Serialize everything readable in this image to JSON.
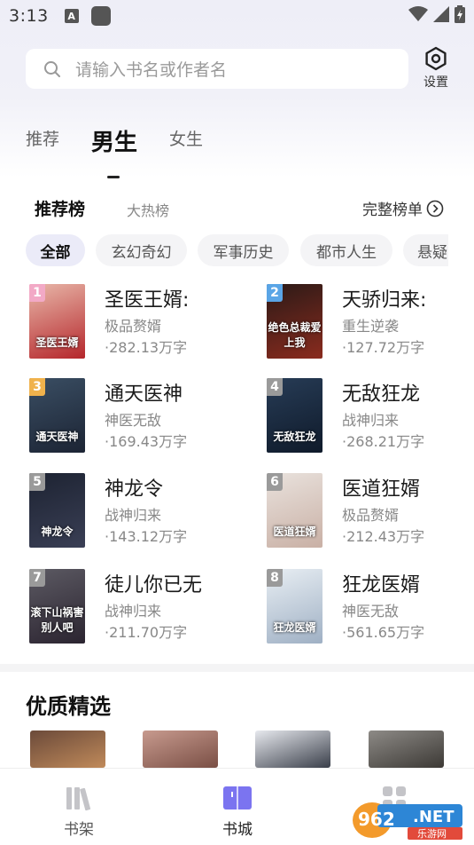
{
  "status_bar": {
    "time": "3:13",
    "icons": [
      "notification-a-icon",
      "app-square-icon",
      "wifi-icon",
      "signal-icon",
      "battery-icon"
    ]
  },
  "search": {
    "placeholder": "请输入书名或作者名",
    "icon": "search-icon"
  },
  "settings": {
    "label": "设置",
    "icon": "gear-icon"
  },
  "gender_tabs": [
    {
      "label": "推荐",
      "active": false
    },
    {
      "label": "男生",
      "active": true
    },
    {
      "label": "女生",
      "active": false
    }
  ],
  "rank_tabs": [
    {
      "label": "推荐榜",
      "active": true
    },
    {
      "label": "大热榜",
      "active": false
    }
  ],
  "full_rank": {
    "label": "完整榜单",
    "icon": "chevron-right-circle-icon"
  },
  "categories": [
    {
      "label": "全部",
      "active": true
    },
    {
      "label": "玄幻奇幻",
      "active": false
    },
    {
      "label": "军事历史",
      "active": false
    },
    {
      "label": "都市人生",
      "active": false
    },
    {
      "label": "悬疑",
      "active": false
    }
  ],
  "books": [
    {
      "rank": "1",
      "title": "圣医王婿:",
      "genre": "极品赘婿",
      "words": "·282.13万字",
      "cover_text": "圣医王婿",
      "badge_color": "#f2a9c6",
      "cover_colors": [
        "#e8b7a9",
        "#b5262b"
      ]
    },
    {
      "rank": "2",
      "title": "天骄归来:",
      "genre": "重生逆袭",
      "words": "·127.72万字",
      "cover_text": "绝色总裁爱上我",
      "badge_color": "#5aa5e6",
      "cover_colors": [
        "#2b1a17",
        "#8a2b1e"
      ]
    },
    {
      "rank": "3",
      "title": "通天医神",
      "genre": "神医无敌",
      "words": "·169.43万字",
      "cover_text": "通天医神",
      "badge_color": "#f0b24c",
      "cover_colors": [
        "#3a4e63",
        "#1c2434"
      ]
    },
    {
      "rank": "4",
      "title": "无敌狂龙",
      "genre": "战神归来",
      "words": "·268.21万字",
      "cover_text": "无敌狂龙",
      "badge_color": "#9a9a9a",
      "cover_colors": [
        "#273c56",
        "#0f1a2a"
      ]
    },
    {
      "rank": "5",
      "title": "神龙令",
      "genre": "战神归来",
      "words": "·143.12万字",
      "cover_text": "神龙令",
      "badge_color": "#9a9a9a",
      "cover_colors": [
        "#1d2332",
        "#3a3f55"
      ]
    },
    {
      "rank": "6",
      "title": "医道狂婿",
      "genre": "极品赘婿",
      "words": "·212.43万字",
      "cover_text": "医道狂婿",
      "badge_color": "#9a9a9a",
      "cover_colors": [
        "#e9e2dd",
        "#c9b0a5"
      ]
    },
    {
      "rank": "7",
      "title": "徒儿你已无",
      "genre": "战神归来",
      "words": "·211.70万字",
      "cover_text": "滚下山祸害别人吧",
      "badge_color": "#9a9a9a",
      "cover_colors": [
        "#5c5a63",
        "#2b2430"
      ]
    },
    {
      "rank": "8",
      "title": "狂龙医婿",
      "genre": "神医无敌",
      "words": "·561.65万字",
      "cover_text": "狂龙医婿",
      "badge_color": "#9a9a9a",
      "cover_colors": [
        "#e8eef3",
        "#9fb0c4"
      ]
    }
  ],
  "quality_section": {
    "title": "优质精选",
    "covers": [
      {
        "colors": [
          "#6b4a3a",
          "#c08a5a"
        ]
      },
      {
        "colors": [
          "#c79a8e",
          "#7a4f45"
        ]
      },
      {
        "colors": [
          "#e7e9ee",
          "#3a3f4a"
        ]
      },
      {
        "colors": [
          "#8d8a86",
          "#3c3935"
        ]
      }
    ]
  },
  "bottom_nav": [
    {
      "label": "书架",
      "icon": "bookshelf-icon",
      "active": false
    },
    {
      "label": "书城",
      "icon": "book-store-icon",
      "active": true
    },
    {
      "label": "",
      "icon": "grid-apps-icon",
      "active": false
    }
  ],
  "watermark": {
    "text": "962.NET",
    "subtext": "乐游网"
  },
  "colors": {
    "accent": "#7b74f0",
    "text_primary": "#111111",
    "text_secondary": "#888888",
    "chip_bg": "#f4f4f6"
  }
}
